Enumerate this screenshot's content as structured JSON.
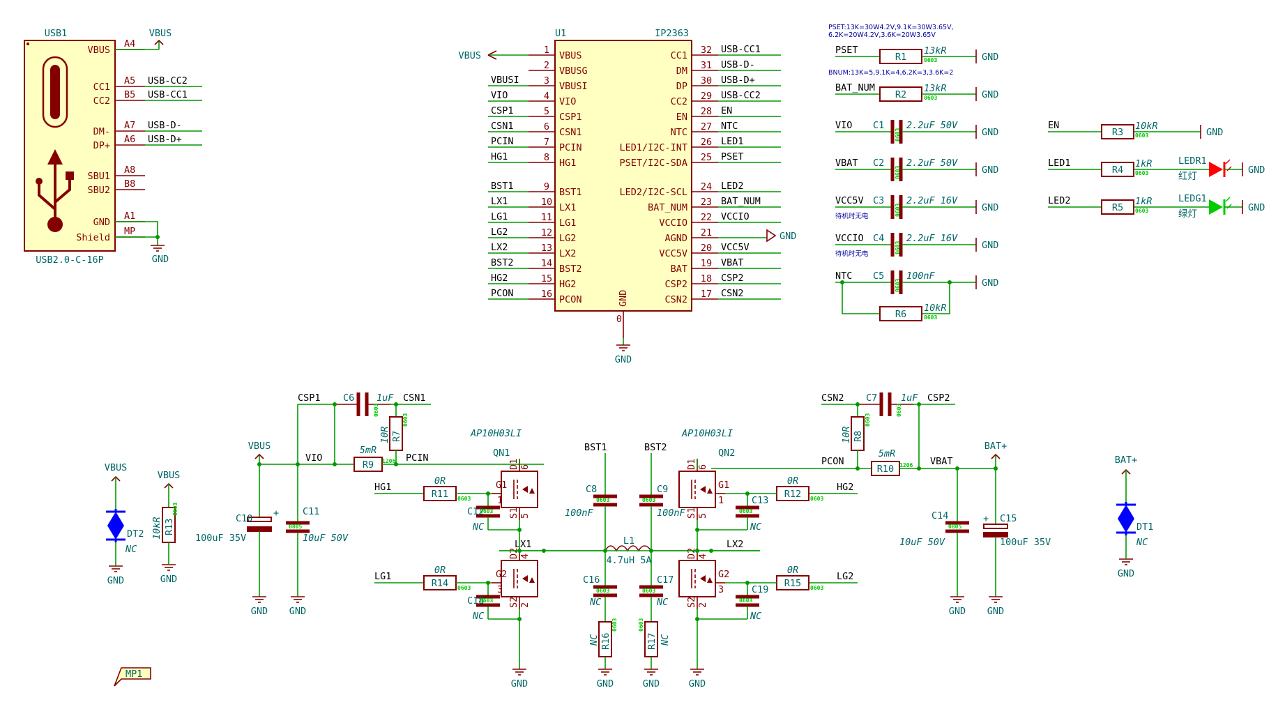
{
  "usb": {
    "ref": "USB1",
    "value": "USB2.0-C-16P",
    "pins": [
      {
        "name": "VBUS",
        "num": "A4",
        "net": ""
      },
      {
        "name": "CC1",
        "num": "A5",
        "net": "USB-CC2"
      },
      {
        "name": "CC2",
        "num": "B5",
        "net": "USB-CC1"
      },
      {
        "name": "DM-",
        "num": "A7",
        "net": "USB-D-"
      },
      {
        "name": "DP+",
        "num": "A6",
        "net": "USB-D+"
      },
      {
        "name": "SBU1",
        "num": "A8",
        "net": ""
      },
      {
        "name": "SBU2",
        "num": "B8",
        "net": ""
      },
      {
        "name": "GND",
        "num": "A1",
        "net": ""
      },
      {
        "name": "Shield",
        "num": "MP",
        "net": ""
      }
    ],
    "vbus_label": "VBUS",
    "gnd_label": "GND"
  },
  "ic": {
    "ref": "U1",
    "value": "IP2363",
    "left_pins": [
      {
        "num": "1",
        "name": "VBUS",
        "net": "VBUS"
      },
      {
        "num": "2",
        "name": "VBUSG",
        "net": ""
      },
      {
        "num": "3",
        "name": "VBUSI",
        "net": "VBUSI"
      },
      {
        "num": "4",
        "name": "VIO",
        "net": "VIO"
      },
      {
        "num": "5",
        "name": "CSP1",
        "net": "CSP1"
      },
      {
        "num": "6",
        "name": "CSN1",
        "net": "CSN1"
      },
      {
        "num": "7",
        "name": "PCIN",
        "net": "PCIN"
      },
      {
        "num": "8",
        "name": "HG1",
        "net": "HG1"
      },
      {
        "num": "9",
        "name": "BST1",
        "net": "BST1"
      },
      {
        "num": "10",
        "name": "LX1",
        "net": "LX1"
      },
      {
        "num": "11",
        "name": "LG1",
        "net": "LG1"
      },
      {
        "num": "12",
        "name": "LG2",
        "net": "LG2"
      },
      {
        "num": "13",
        "name": "LX2",
        "net": "LX2"
      },
      {
        "num": "14",
        "name": "BST2",
        "net": "BST2"
      },
      {
        "num": "15",
        "name": "HG2",
        "net": "HG2"
      },
      {
        "num": "16",
        "name": "PCON",
        "net": "PCON"
      }
    ],
    "right_pins": [
      {
        "num": "32",
        "name": "CC1",
        "net": "USB-CC1"
      },
      {
        "num": "31",
        "name": "DM",
        "net": "USB-D-"
      },
      {
        "num": "30",
        "name": "DP",
        "net": "USB-D+"
      },
      {
        "num": "29",
        "name": "CC2",
        "net": "USB-CC2"
      },
      {
        "num": "28",
        "name": "EN",
        "net": "EN"
      },
      {
        "num": "27",
        "name": "NTC",
        "net": "NTC"
      },
      {
        "num": "26",
        "name": "LED1/I2C-INT",
        "net": "LED1"
      },
      {
        "num": "25",
        "name": "PSET/I2C-SDA",
        "net": "PSET"
      },
      {
        "num": "24",
        "name": "LED2/I2C-SCL",
        "net": "LED2"
      },
      {
        "num": "23",
        "name": "BAT_NUM",
        "net": "BAT_NUM"
      },
      {
        "num": "22",
        "name": "VCCIO",
        "net": "VCCIO"
      },
      {
        "num": "21",
        "name": "AGND",
        "net": "GND"
      },
      {
        "num": "20",
        "name": "VCC5V",
        "net": "VCC5V"
      },
      {
        "num": "19",
        "name": "BAT",
        "net": "VBAT"
      },
      {
        "num": "18",
        "name": "CSP2",
        "net": "CSP2"
      },
      {
        "num": "17",
        "name": "CSN2",
        "net": "CSN2"
      }
    ],
    "bottom_pin": {
      "num": "0",
      "name": "GND",
      "net": "GND"
    }
  },
  "config": {
    "pset_note_1": "PSET:13K=30W4.2V,9.1K=30W3.65V,",
    "pset_note_2": "6.2K=20W4.2V,3.6K=20W3.65V",
    "bnum_note": "BNUM:13K=5,9.1K=4,6.2K=3,3.6K=2",
    "rows": [
      {
        "net": "PSET",
        "ref": "R1",
        "value": "13kR",
        "pkg": "0603",
        "kind": "R",
        "note": ""
      },
      {
        "net": "BAT_NUM",
        "ref": "R2",
        "value": "13kR",
        "pkg": "0603",
        "kind": "R",
        "note": ""
      },
      {
        "net": "VIO",
        "ref": "C1",
        "value": "2.2uF 50V",
        "pkg": "0603",
        "kind": "C",
        "note": ""
      },
      {
        "net": "VBAT",
        "ref": "C2",
        "value": "2.2uF 50V",
        "pkg": "0603",
        "kind": "C",
        "note": ""
      },
      {
        "net": "VCC5V",
        "ref": "C3",
        "value": "2.2uF 16V",
        "pkg": "0603",
        "kind": "C",
        "note": "待机时无电"
      },
      {
        "net": "VCCIO",
        "ref": "C4",
        "value": "2.2uF 16V",
        "pkg": "0603",
        "kind": "C",
        "note": "待机时无电"
      },
      {
        "net": "NTC",
        "ref": "C5",
        "value": "100nF",
        "pkg": "0603",
        "kind": "C",
        "note": ""
      }
    ],
    "r6": {
      "ref": "R6",
      "value": "10kR",
      "pkg": "0603"
    }
  },
  "leds": {
    "rows": [
      {
        "net": "EN",
        "ref": "R3",
        "value": "10kR",
        "pkg": "0603",
        "led": "",
        "led_label": ""
      },
      {
        "net": "LED1",
        "ref": "R4",
        "value": "1kR",
        "pkg": "0603",
        "led": "LEDR1",
        "led_label": "红灯",
        "color": "#ff0000"
      },
      {
        "net": "LED2",
        "ref": "R5",
        "value": "1kR",
        "pkg": "0603",
        "led": "LEDG1",
        "led_label": "绿灯",
        "color": "#00cc00"
      }
    ]
  },
  "power": {
    "csp1": "CSP1",
    "csn1": "CSN1",
    "csp2": "CSP2",
    "csn2": "CSN2",
    "c6": {
      "ref": "C6",
      "value": "1uF",
      "pkg": "0603"
    },
    "c7": {
      "ref": "C7",
      "value": "1uF",
      "pkg": "0603"
    },
    "r7": {
      "ref": "R7",
      "value": "10R",
      "pkg": "0603"
    },
    "r8": {
      "ref": "R8",
      "value": "10R",
      "pkg": "0603"
    },
    "r9": {
      "ref": "R9",
      "value": "5mR",
      "pkg": "1206"
    },
    "r10": {
      "ref": "R10",
      "value": "5mR",
      "pkg": "1206"
    },
    "vbus": "VBUS",
    "vio": "VIO",
    "pcin": "PCIN",
    "pcon": "PCON",
    "vbat": "VBAT",
    "batp": "BAT+",
    "c10": {
      "ref": "C10",
      "value": "100uF 35V"
    },
    "c11": {
      "ref": "C11",
      "value": "10uF 50V",
      "pkg": "0805"
    },
    "c14": {
      "ref": "C14",
      "value": "10uF 50V",
      "pkg": "0805"
    },
    "c15": {
      "ref": "C15",
      "value": "100uF 35V"
    },
    "mos_value": "AP10H03LI",
    "qn1": "QN1",
    "qn2": "QN2",
    "bst1": "BST1",
    "bst2": "BST2",
    "c8": {
      "ref": "C8",
      "value": "100nF",
      "pkg": "0603"
    },
    "c9": {
      "ref": "C9",
      "value": "100nF",
      "pkg": "0603"
    },
    "l1": {
      "ref": "L1",
      "value": "4.7uH 5A"
    },
    "hg1": "HG1",
    "hg2": "HG2",
    "lg1": "LG1",
    "lg2": "LG2",
    "lx1": "LX1",
    "lx2": "LX2",
    "r11": {
      "ref": "R11",
      "value": "0R",
      "pkg": "0603"
    },
    "r12": {
      "ref": "R12",
      "value": "0R",
      "pkg": "0603"
    },
    "r14": {
      "ref": "R14",
      "value": "0R",
      "pkg": "0603"
    },
    "r15": {
      "ref": "R15",
      "value": "0R",
      "pkg": "0603"
    },
    "c12": {
      "ref": "C12",
      "value": "NC",
      "pkg": "0603"
    },
    "c13": {
      "ref": "C13",
      "value": "NC",
      "pkg": "0603"
    },
    "c18": {
      "ref": "C18",
      "value": "NC",
      "pkg": "0603"
    },
    "c19": {
      "ref": "C19",
      "value": "NC",
      "pkg": "0603"
    },
    "c16": {
      "ref": "C16",
      "value": "NC",
      "pkg": "0603"
    },
    "c17": {
      "ref": "C17",
      "value": "NC",
      "pkg": "0603"
    },
    "r16": {
      "ref": "R16",
      "value": "NC",
      "pkg": "0603"
    },
    "r17": {
      "ref": "R17",
      "value": "NC",
      "pkg": "0603"
    },
    "gnd": "GND"
  },
  "misc": {
    "dt2": {
      "ref": "DT2",
      "value": "NC",
      "net": "VBUS"
    },
    "dt1": {
      "ref": "DT1",
      "value": "NC",
      "net": "BAT+"
    },
    "r13": {
      "ref": "R13",
      "value": "10kR",
      "pkg": "0603",
      "net": "VBUS"
    },
    "mp1": "MP1"
  }
}
